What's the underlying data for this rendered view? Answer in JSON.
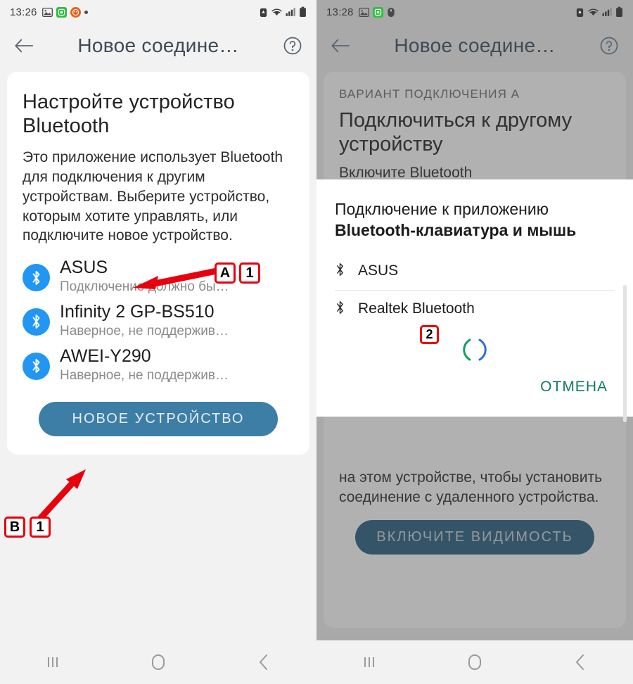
{
  "left_phone": {
    "status_bar": {
      "time": "13:26",
      "left_icons": [
        "gallery-icon",
        "green-app-badge-icon",
        "orange-app-badge-icon",
        "dot-icon"
      ],
      "right_icons": [
        "alarm-icon",
        "wifi-icon",
        "signal-icon",
        "battery-icon"
      ]
    },
    "app_bar": {
      "back_icon": "arrow-left-icon",
      "title": "Новое соедине…",
      "help_icon": "help-circle-icon"
    },
    "card": {
      "heading": "Настройте устройство Bluetooth",
      "body": "Это приложение использует Bluetooth для подключения к другим устройствам. Выберите устройство, которым хотите управлять, или подключите новое устройство.",
      "devices": [
        {
          "name": "ASUS",
          "subtitle": "Подключение должно бы…"
        },
        {
          "name": "Infinity 2 GP-BS510",
          "subtitle": "Наверное, не поддержив…"
        },
        {
          "name": "AWEI-Y290",
          "subtitle": "Наверное, не поддержив…"
        }
      ],
      "primary_button": "НОВОЕ УСТРОЙСТВО"
    },
    "annotations": [
      {
        "id": "marker-a",
        "label": "A"
      },
      {
        "id": "marker-a-step",
        "label": "1"
      },
      {
        "id": "marker-b",
        "label": "B"
      },
      {
        "id": "marker-b-step",
        "label": "1"
      }
    ],
    "nav_bar": {
      "recents_icon": "recents-icon",
      "home_icon": "home-icon",
      "back_icon": "back-chevron-icon"
    }
  },
  "right_phone": {
    "status_bar": {
      "time": "13:28",
      "left_icons": [
        "gallery-icon",
        "green-app-badge-icon",
        "mouse-icon"
      ],
      "right_icons": [
        "alarm-icon",
        "wifi-icon",
        "signal-icon",
        "battery-icon"
      ]
    },
    "app_bar": {
      "back_icon": "arrow-left-icon",
      "title": "Новое соедине…",
      "help_icon": "help-circle-icon"
    },
    "card": {
      "eyebrow": "ВАРИАНТ ПОДКЛЮЧЕНИЯ А",
      "heading": "Подключиться к другому устройству",
      "body_hidden": "Включите Bluetooth",
      "body_visible": "на этом устройстве, чтобы установить соединение с удаленного устройства.",
      "primary_button": "ВКЛЮЧИТЕ ВИДИМОСТЬ"
    },
    "dialog": {
      "title_regular": "Подключение к приложению",
      "title_bold": "Bluetooth-клавиатура и мышь",
      "devices": [
        {
          "name": "ASUS",
          "icon": "bluetooth-icon"
        },
        {
          "name": "Realtek Bluetooth",
          "icon": "bluetooth-icon"
        }
      ],
      "spinner": "loading-spinner",
      "cancel_button": "ОТМЕНА",
      "scrollbar": "vertical-scrollbar"
    },
    "annotations": [
      {
        "id": "marker-2",
        "label": "2"
      }
    ],
    "nav_bar": {
      "recents_icon": "recents-icon",
      "home_icon": "home-icon",
      "back_icon": "back-chevron-icon"
    }
  },
  "colors": {
    "bluetooth_blue": "#2196f3",
    "primary_button": "#3d7ea6",
    "primary_button_dark": "#2a5f80",
    "cancel_teal": "#0f7a63",
    "marker_red": "#e8000d",
    "arrow_red": "#e8000d",
    "page_background": "#f2f2f2"
  }
}
